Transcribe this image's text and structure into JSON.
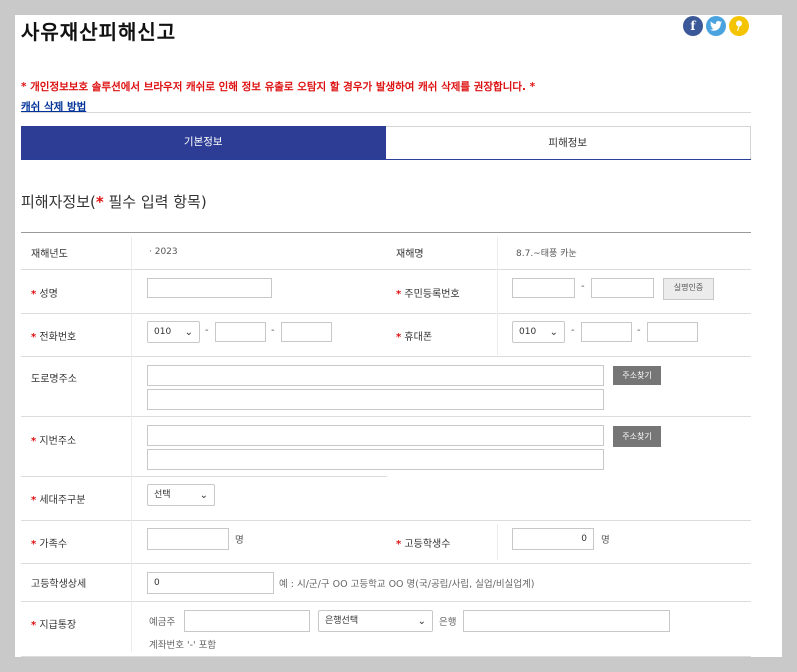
{
  "title": "사유재산피해신고",
  "social": [
    {
      "name": "facebook-icon",
      "glyph": "f",
      "color": "#3b5998"
    },
    {
      "name": "twitter-icon",
      "glyph": "t",
      "color": "#4aa3df"
    },
    {
      "name": "kakaostory-icon",
      "glyph": "❜",
      "color": "#f5c400"
    }
  ],
  "notice": "* 개인정보보호 솔루션에서 브라우저 캐쉬로 인해 정보 유출로 오탐지 할 경우가 발생하여 캐쉬 삭제를 권장합니다. *",
  "cache_link": "캐쉬 삭제 방법",
  "tabs": {
    "basic": "기본정보",
    "damage": "피해정보"
  },
  "section_title": "피해자정보(",
  "section_title_star": "*",
  "section_title_rest": " 필수 입력 항목)",
  "req": "*",
  "form": {
    "year_label": "재해년도",
    "year_value": "· 2023",
    "disaster_label": "재해명",
    "disaster_value": "8.7.~태풍 카눈",
    "name_label": "성명",
    "rrn_label": "주민등록번호",
    "rrn_dash": "-",
    "verify_button": "실명인증",
    "phone_label": "전화번호",
    "phone_prefix": "010",
    "phone_dash": "-",
    "mobile_label": "휴대폰",
    "mobile_prefix": "010",
    "road_label": "도로명주소",
    "addr_button": "주소찾기",
    "lot_label": "지번주소",
    "household_label": "세대주구분",
    "household_select": "선택",
    "family_label": "가족수",
    "person_unit": "명",
    "hs_label": "고등학생수",
    "hs_value": "0",
    "hs_detail_label": "고등학생상세",
    "hs_detail_value": "0",
    "hs_detail_hint": "예 : 시/군/구 OO 고등학교 OO 명(국/공립/사립, 실업/비실업계)",
    "account_label": "지급통장",
    "depositor_label": "예금주",
    "bank_select": "은행선택",
    "bank_unit": "은행",
    "account_hint": "계좌번호 '-' 포함"
  }
}
